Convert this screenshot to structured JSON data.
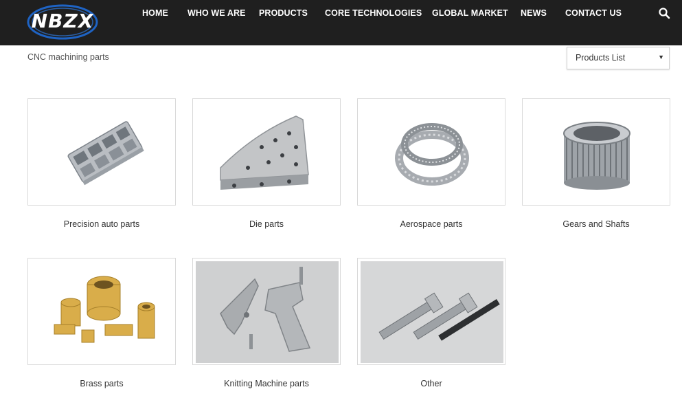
{
  "brand": {
    "logo_text": "NBZX"
  },
  "nav": {
    "items": [
      {
        "label": "HOME"
      },
      {
        "label": "WHO WE ARE"
      },
      {
        "label": "PRODUCTS"
      },
      {
        "label": "CORE TECHNOLOGIES"
      },
      {
        "label": "GLOBAL MARKET"
      },
      {
        "label": "NEWS"
      },
      {
        "label": "CONTACT US"
      }
    ],
    "search_icon": "search-icon"
  },
  "breadcrumb": "CNC machining parts",
  "products_select": {
    "selected": "Products List"
  },
  "products": [
    {
      "label": "Precision auto parts"
    },
    {
      "label": "Die parts"
    },
    {
      "label": "Aerospace parts"
    },
    {
      "label": "Gears and Shafts"
    },
    {
      "label": "Brass parts"
    },
    {
      "label": "Knitting Machine parts"
    },
    {
      "label": "Other"
    }
  ],
  "colors": {
    "header_bg": "#1f1f1f",
    "logo_blue": "#1e63c4"
  }
}
